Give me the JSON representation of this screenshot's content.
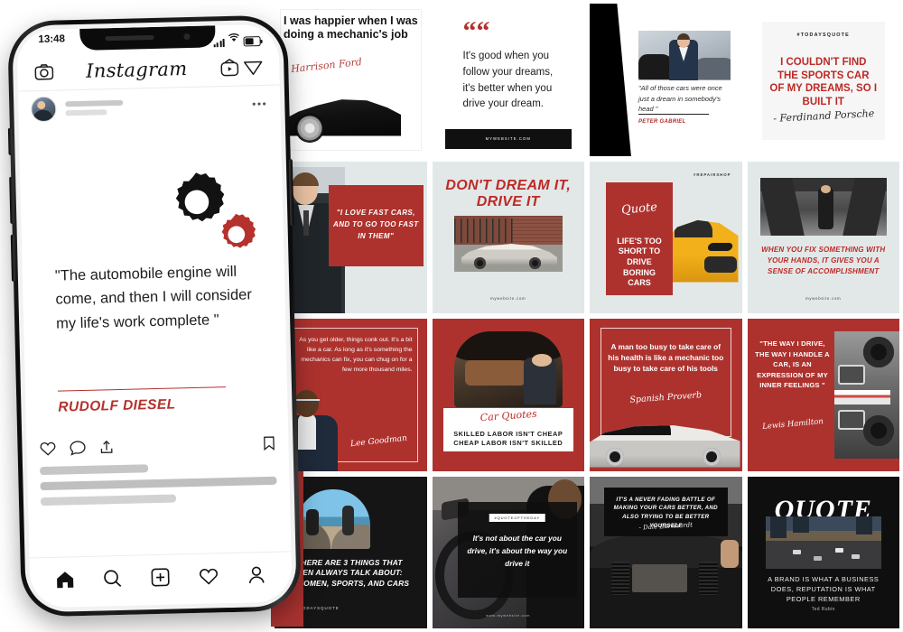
{
  "phone": {
    "status": {
      "time": "13:48",
      "signal_icon": "signal-bars-icon",
      "wifi_icon": "wifi-icon",
      "battery_icon": "battery-icon"
    },
    "app": {
      "logo_text": "Instagram",
      "camera_icon": "camera-icon",
      "igtv_icon": "igtv-icon",
      "direct_icon": "send-direct-icon",
      "more_icon": "more-options-icon"
    },
    "post": {
      "gear_big_icon": "gear-icon",
      "gear_small_icon": "gear-icon",
      "quote": "\"The automobile engine will come, and then I will consider my life's work complete \"",
      "author": "RUDOLF DIESEL",
      "accent_color": "#b4312d",
      "like_icon": "heart-icon",
      "comment_icon": "comment-icon",
      "share_icon": "share-icon",
      "save_icon": "bookmark-icon"
    },
    "tabbar": {
      "home_icon": "home-icon",
      "search_icon": "search-icon",
      "add_icon": "add-post-icon",
      "activity_icon": "heart-icon",
      "profile_icon": "profile-icon"
    }
  },
  "palette": {
    "red": "#a83230",
    "red_text": "#bd2a26",
    "light_cell": "#e2e8e8",
    "dark_cell": "#151515",
    "white": "#ffffff"
  },
  "grid": {
    "posts": [
      {
        "id": "post-i-was-happier",
        "style": "white",
        "quote": "I was happier when I was doing a mechanic's job",
        "signature": "Harrison Ford",
        "image_alt": "black-sports-car-photo"
      },
      {
        "id": "post-follow-your-dreams",
        "style": "white",
        "quote_mark": "““",
        "quote": "It's good when you follow your dreams, it's better when you drive your dream.",
        "footer": "MYWEBSITE.COM"
      },
      {
        "id": "post-peter-gabriel",
        "style": "white",
        "quote": "\"All of those cars were once just a dream in somebody's head \"",
        "author": "PETER GABRIEL",
        "image_alt": "car-salesman-in-showroom-photo"
      },
      {
        "id": "post-ferdinand-porsche",
        "style": "white",
        "tag": "#TODAYSQUOTE",
        "quote": "I COULDN'T FIND THE SPORTS CAR OF MY DREAMS, SO I BUILT IT",
        "signature": "- Ferdinand Porsche"
      },
      {
        "id": "post-i-love-fast-cars",
        "style": "light",
        "quote": "\"I LOVE FAST CARS, AND TO GO TOO FAST IN THEM\"",
        "image_alt": "man-in-suit-photo"
      },
      {
        "id": "post-dont-dream-it",
        "style": "light",
        "heading": "DON'T DREAM IT, DRIVE IT",
        "footer": "mywebsite.com",
        "image_alt": "white-lamborghini-photo"
      },
      {
        "id": "post-lifes-too-short",
        "style": "light",
        "tag": "#REPAIRSHOP",
        "script": "Quote",
        "quote": "LIFE'S TOO SHORT TO DRIVE BORING CARS",
        "image_alt": "yellow-audi-tt-photo"
      },
      {
        "id": "post-when-you-fix",
        "style": "light",
        "quote": "WHEN YOU FIX SOMETHING WITH YOUR HANDS, IT GIVES YOU A SENSE OF ACCOMPLISHMENT",
        "footer": "mywebsite.com",
        "image_alt": "mechanic-under-car-lift-photo"
      },
      {
        "id": "post-lee-goodman",
        "style": "red",
        "quote": "As you get older, things conk out. It's a bit like a car. As long as it's something the mechanics can fix, you can chug on for a few more thousand miles.",
        "signature": "Lee Goodman",
        "image_alt": "woman-in-blazer-photo"
      },
      {
        "id": "post-car-quotes",
        "style": "red",
        "script": "Car Quotes",
        "line1": "SKILLED LABOR ISN'T CHEAP",
        "line2": "CHEAP LABOR ISN'T SKILLED",
        "image_alt": "mechanic-working-on-engine-photo"
      },
      {
        "id": "post-spanish-proverb",
        "style": "red",
        "quote": "A man too busy to take care of his health is like a mechanic too busy to take care of his tools",
        "signature": "Spanish Proverb",
        "image_alt": "silver-corvette-photo"
      },
      {
        "id": "post-lewis-hamilton",
        "style": "red",
        "quote": "\"THE WAY I DRIVE, THE WAY I HANDLE A CAR, IS AN EXPRESSION OF MY INNER FEELINGS \"",
        "signature": "Lewis Hamilton",
        "image_alt": "race-car-tires-photo"
      },
      {
        "id": "post-three-things",
        "style": "black",
        "quote": "THERE ARE 3 THINGS THAT MEN ALWAYS TALK ABOUT: WOMEN, SPORTS, AND CARS",
        "tag": "#TODAYSQUOTE",
        "image_alt": "two-men-on-rocks-photo"
      },
      {
        "id": "post-quote-of-the-day",
        "style": "photo",
        "tag": "#QUOTEOFTHEDAY",
        "quote": "It's not about the car you drive, it's about the way you drive it",
        "footer": "www.mywebsite.com",
        "image_alt": "chauffeur-driving-photo"
      },
      {
        "id": "post-never-fading-battle",
        "style": "photo",
        "quote": "IT'S A NEVER FADING BATTLE OF MAKING YOUR CARS BETTER, AND ALSO TRYING TO BE BETTER YOURSELF",
        "signature": "- Dale Earnhardt",
        "image_alt": "car-dashboard-interior-photo"
      },
      {
        "id": "post-brand-reputation",
        "style": "black",
        "title": "QUOTE",
        "quote": "A BRAND IS WHAT A BUSINESS DOES, REPUTATION IS WHAT PEOPLE REMEMBER",
        "author": "Ted Rubin",
        "image_alt": "city-traffic-at-dusk-photo"
      }
    ]
  }
}
